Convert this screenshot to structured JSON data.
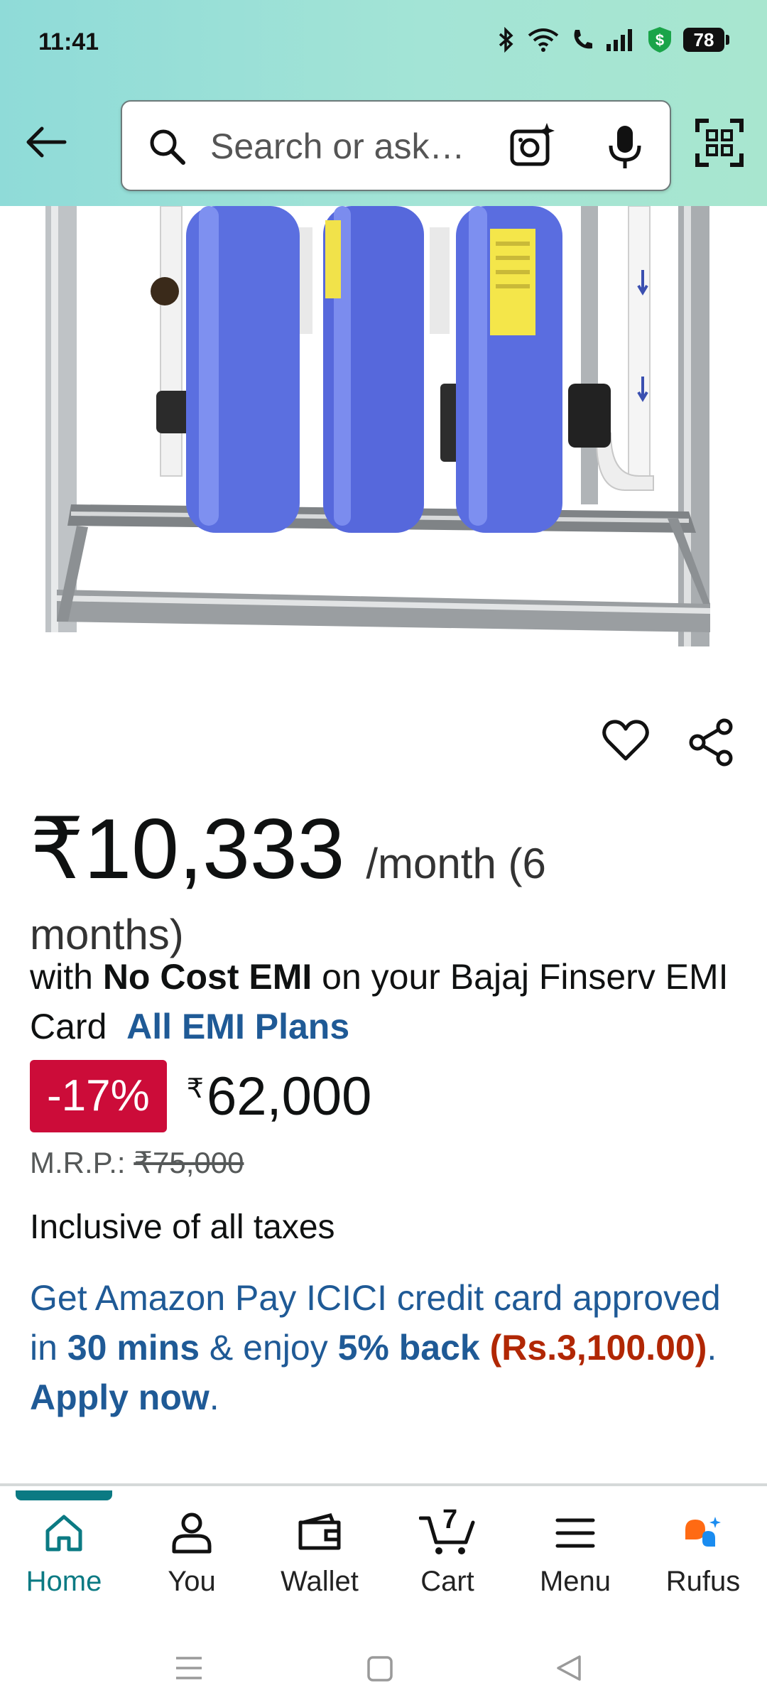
{
  "status_bar": {
    "time": "11:41",
    "battery": "78"
  },
  "search": {
    "placeholder": "Search or ask…"
  },
  "price": {
    "emi_amount": "₹10,333",
    "emi_period": "/month (6",
    "emi_period_end": "months)",
    "emi_prefix": "with ",
    "emi_bold": "No Cost EMI",
    "emi_suffix": " on your Bajaj Finserv EMI Card",
    "emi_link": "All EMI Plans",
    "discount": "-17%",
    "currency": "₹",
    "deal_price": "62,000",
    "mrp_label": "M.R.P.: ",
    "mrp_value": "₹75,000",
    "tax_note": "Inclusive of all taxes"
  },
  "offer": {
    "part1": "Get Amazon Pay ICICI credit card approved in ",
    "mins": "30 mins",
    "part2": " & enjoy ",
    "back": "5% back",
    "space": " ",
    "amount": "(Rs.3,100.00)",
    "dot": ". ",
    "apply": "Apply now",
    "end": "."
  },
  "nav": {
    "home": "Home",
    "you": "You",
    "wallet": "Wallet",
    "cart": "Cart",
    "cart_count": "7",
    "menu": "Menu",
    "rufus": "Rufus"
  },
  "colors": {
    "accent": "#0b7a83",
    "badge": "#cc0c39",
    "link": "#1f5a96",
    "price_red": "#b12704"
  }
}
